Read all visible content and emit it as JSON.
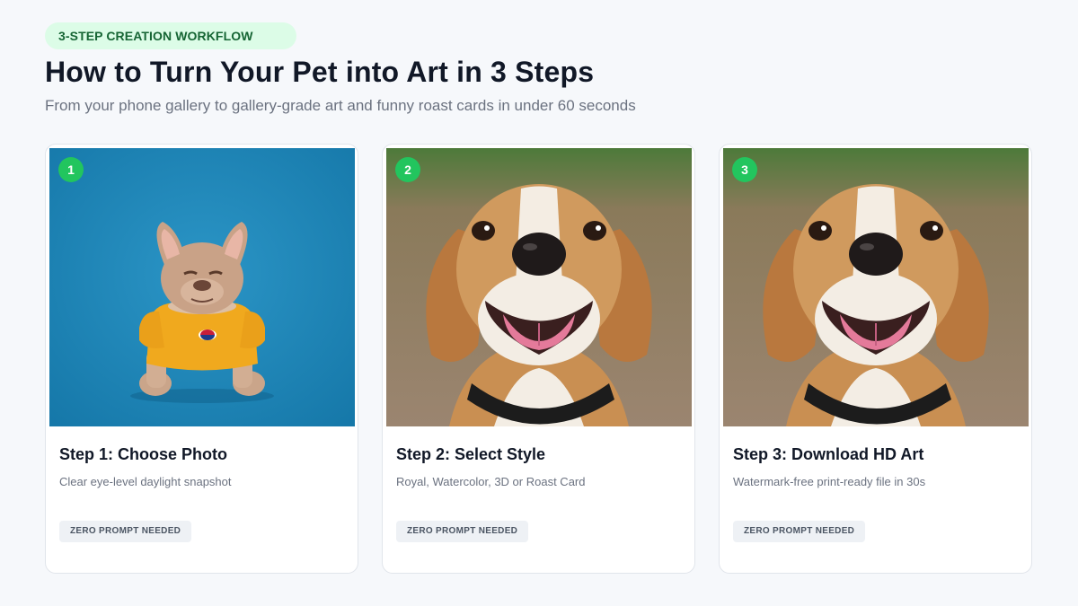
{
  "badge": "3-STEP CREATION WORKFLOW",
  "title": "How to Turn Your Pet into Art in 3 Steps",
  "subtitle": "From your phone gallery to gallery-grade art and funny roast cards in under 60 seconds",
  "steps": [
    {
      "number": "1",
      "title": "Step 1: Choose Photo",
      "description": "Clear eye-level daylight snapshot",
      "tag": "ZERO PROMPT NEEDED"
    },
    {
      "number": "2",
      "title": "Step 2: Select Style",
      "description": "Royal, Watercolor, 3D or Roast Card",
      "tag": "ZERO PROMPT NEEDED"
    },
    {
      "number": "3",
      "title": "Step 3: Download HD Art",
      "description": "Watermark-free print-ready file in 30s",
      "tag": "ZERO PROMPT NEEDED"
    }
  ],
  "colors": {
    "accent": "#22c55e",
    "badge_bg": "#dcfce7",
    "badge_text": "#166534"
  }
}
